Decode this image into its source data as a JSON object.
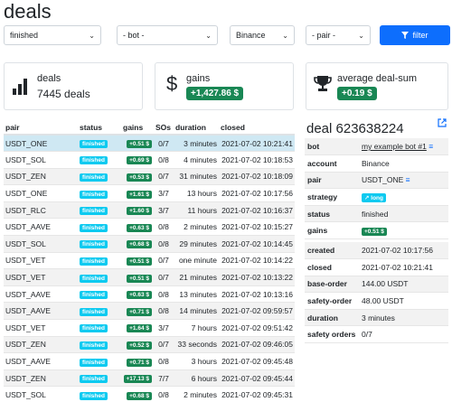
{
  "page": {
    "title": "deals"
  },
  "filters": {
    "status": "finished",
    "bot": "- bot -",
    "exchange": "Binance",
    "pair": "- pair -",
    "button_label": "filter"
  },
  "cards": {
    "deals": {
      "label": "deals",
      "value": "7445 deals"
    },
    "gains": {
      "label": "gains",
      "value": "+1,427.86 $"
    },
    "avg": {
      "label": "average deal-sum",
      "value": "+0.19 $"
    }
  },
  "table": {
    "headers": {
      "pair": "pair",
      "status": "status",
      "gains": "gains",
      "sos": "SOs",
      "duration": "duration",
      "closed": "closed"
    },
    "rows": [
      {
        "pair": "USDT_ONE",
        "status": "finished",
        "gains": "+0.51 $",
        "sos": "0/7",
        "duration": "3 minutes",
        "closed": "2021-07-02 10:21:41"
      },
      {
        "pair": "USDT_SOL",
        "status": "finished",
        "gains": "+0.69 $",
        "sos": "0/8",
        "duration": "4 minutes",
        "closed": "2021-07-02 10:18:53"
      },
      {
        "pair": "USDT_ZEN",
        "status": "finished",
        "gains": "+0.53 $",
        "sos": "0/7",
        "duration": "31 minutes",
        "closed": "2021-07-02 10:18:09"
      },
      {
        "pair": "USDT_ONE",
        "status": "finished",
        "gains": "+1.61 $",
        "sos": "3/7",
        "duration": "13 hours",
        "closed": "2021-07-02 10:17:56"
      },
      {
        "pair": "USDT_RLC",
        "status": "finished",
        "gains": "+1.60 $",
        "sos": "3/7",
        "duration": "11 hours",
        "closed": "2021-07-02 10:16:37"
      },
      {
        "pair": "USDT_AAVE",
        "status": "finished",
        "gains": "+0.63 $",
        "sos": "0/8",
        "duration": "2 minutes",
        "closed": "2021-07-02 10:15:27"
      },
      {
        "pair": "USDT_SOL",
        "status": "finished",
        "gains": "+0.68 $",
        "sos": "0/8",
        "duration": "29 minutes",
        "closed": "2021-07-02 10:14:45"
      },
      {
        "pair": "USDT_VET",
        "status": "finished",
        "gains": "+0.51 $",
        "sos": "0/7",
        "duration": "one minute",
        "closed": "2021-07-02 10:14:22"
      },
      {
        "pair": "USDT_VET",
        "status": "finished",
        "gains": "+0.51 $",
        "sos": "0/7",
        "duration": "21 minutes",
        "closed": "2021-07-02 10:13:22"
      },
      {
        "pair": "USDT_AAVE",
        "status": "finished",
        "gains": "+0.63 $",
        "sos": "0/8",
        "duration": "13 minutes",
        "closed": "2021-07-02 10:13:16"
      },
      {
        "pair": "USDT_AAVE",
        "status": "finished",
        "gains": "+0.71 $",
        "sos": "0/8",
        "duration": "14 minutes",
        "closed": "2021-07-02 09:59:57"
      },
      {
        "pair": "USDT_VET",
        "status": "finished",
        "gains": "+1.64 $",
        "sos": "3/7",
        "duration": "7 hours",
        "closed": "2021-07-02 09:51:42"
      },
      {
        "pair": "USDT_ZEN",
        "status": "finished",
        "gains": "+0.52 $",
        "sos": "0/7",
        "duration": "33 seconds",
        "closed": "2021-07-02 09:46:05"
      },
      {
        "pair": "USDT_AAVE",
        "status": "finished",
        "gains": "+0.71 $",
        "sos": "0/8",
        "duration": "3 hours",
        "closed": "2021-07-02 09:45:48"
      },
      {
        "pair": "USDT_ZEN",
        "status": "finished",
        "gains": "+17.13 $",
        "sos": "7/7",
        "duration": "6 hours",
        "closed": "2021-07-02 09:45:44"
      },
      {
        "pair": "USDT_SOL",
        "status": "finished",
        "gains": "+0.68 $",
        "sos": "0/8",
        "duration": "2 minutes",
        "closed": "2021-07-02 09:45:31"
      },
      {
        "pair": "USDT_BAKE",
        "status": "finished",
        "gains": "+0.63 $",
        "sos": "0/8",
        "duration": "one minute",
        "closed": "2021-07-02 09:45:21"
      }
    ]
  },
  "detail": {
    "title": "deal 623638224",
    "rows_a": [
      {
        "key": "bot",
        "value": "my example bot #1"
      },
      {
        "key": "account",
        "value": "Binance"
      },
      {
        "key": "pair",
        "value": "USDT_ONE"
      },
      {
        "key": "strategy",
        "value": "long"
      },
      {
        "key": "status",
        "value": "finished"
      },
      {
        "key": "gains",
        "value": "+0.51 $"
      }
    ],
    "rows_b": [
      {
        "key": "created",
        "value": "2021-07-02 10:17:56"
      },
      {
        "key": "closed",
        "value": "2021-07-02 10:21:41"
      },
      {
        "key": "base-order",
        "value": "144.00 USDT"
      },
      {
        "key": "safety-order",
        "value": "48.00 USDT"
      },
      {
        "key": "duration",
        "value": "3 minutes"
      },
      {
        "key": "safety orders",
        "value": "0/7"
      }
    ]
  },
  "colors": {
    "primary": "#0d6efd",
    "success": "#198754",
    "info": "#0dcaf0",
    "selected_row": "#cfe8f3"
  },
  "icons": [
    "bar-chart-icon",
    "dollar-icon",
    "trophy-icon",
    "filter-icon",
    "external-link-icon",
    "list-icon",
    "arrow-up-right-icon",
    "chevron-down-icon"
  ]
}
